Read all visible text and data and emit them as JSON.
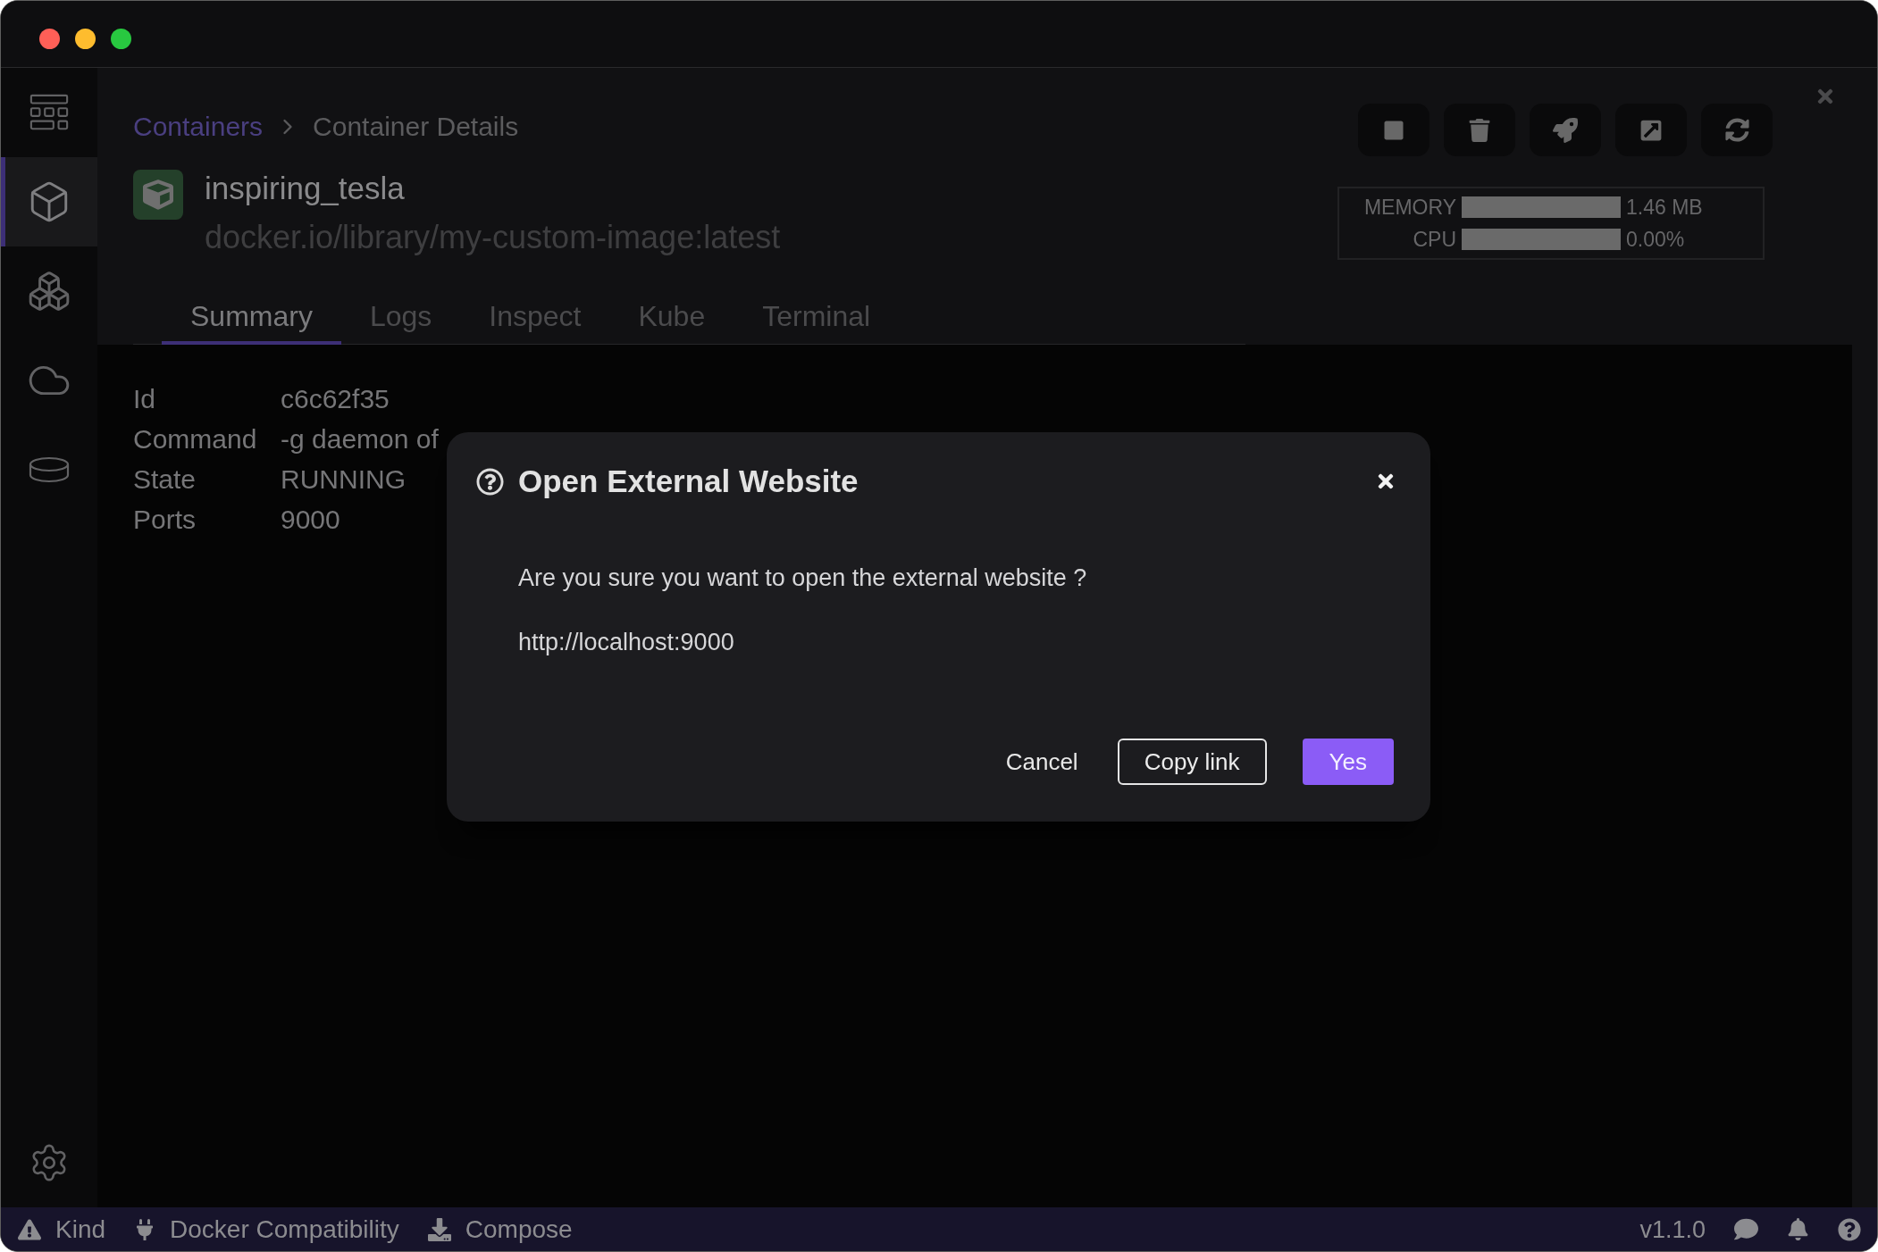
{
  "sidebar": {
    "items": [
      {
        "selected": false
      },
      {
        "selected": true
      },
      {
        "selected": false
      },
      {
        "selected": false
      },
      {
        "selected": false
      }
    ]
  },
  "breadcrumb": {
    "parent": "Containers",
    "current": "Container Details"
  },
  "container": {
    "name": "inspiring_tesla",
    "image": "docker.io/library/my-custom-image:latest"
  },
  "stats": [
    {
      "label": "MEMORY",
      "level": 1,
      "reading": "1.46 MB"
    },
    {
      "label": "CPU",
      "level": 1,
      "reading": "0.00%"
    }
  ],
  "tabs": [
    {
      "label": "Summary",
      "selected": true
    },
    {
      "label": "Logs",
      "selected": false
    },
    {
      "label": "Inspect",
      "selected": false
    },
    {
      "label": "Kube",
      "selected": false
    },
    {
      "label": "Terminal",
      "selected": false
    }
  ],
  "details": [
    {
      "label": "Id",
      "value": "c6c62f35"
    },
    {
      "label": "Command",
      "value": "-g daemon of"
    },
    {
      "label": "State",
      "value": "RUNNING"
    },
    {
      "label": "Ports",
      "value": "9000"
    }
  ],
  "dialog": {
    "title": "Open External Website",
    "message": "Are you sure you want to open the external website ?",
    "url": "http://localhost:9000",
    "buttons": [
      {
        "label": "Cancel",
        "kind": "text"
      },
      {
        "label": "Copy link",
        "kind": "outline"
      },
      {
        "label": "Yes",
        "kind": "primary"
      }
    ]
  },
  "status_bar": {
    "items": [
      {
        "label": "Kind"
      },
      {
        "label": "Docker Compatibility"
      },
      {
        "label": "Compose"
      }
    ],
    "version": "v1.1.0"
  }
}
